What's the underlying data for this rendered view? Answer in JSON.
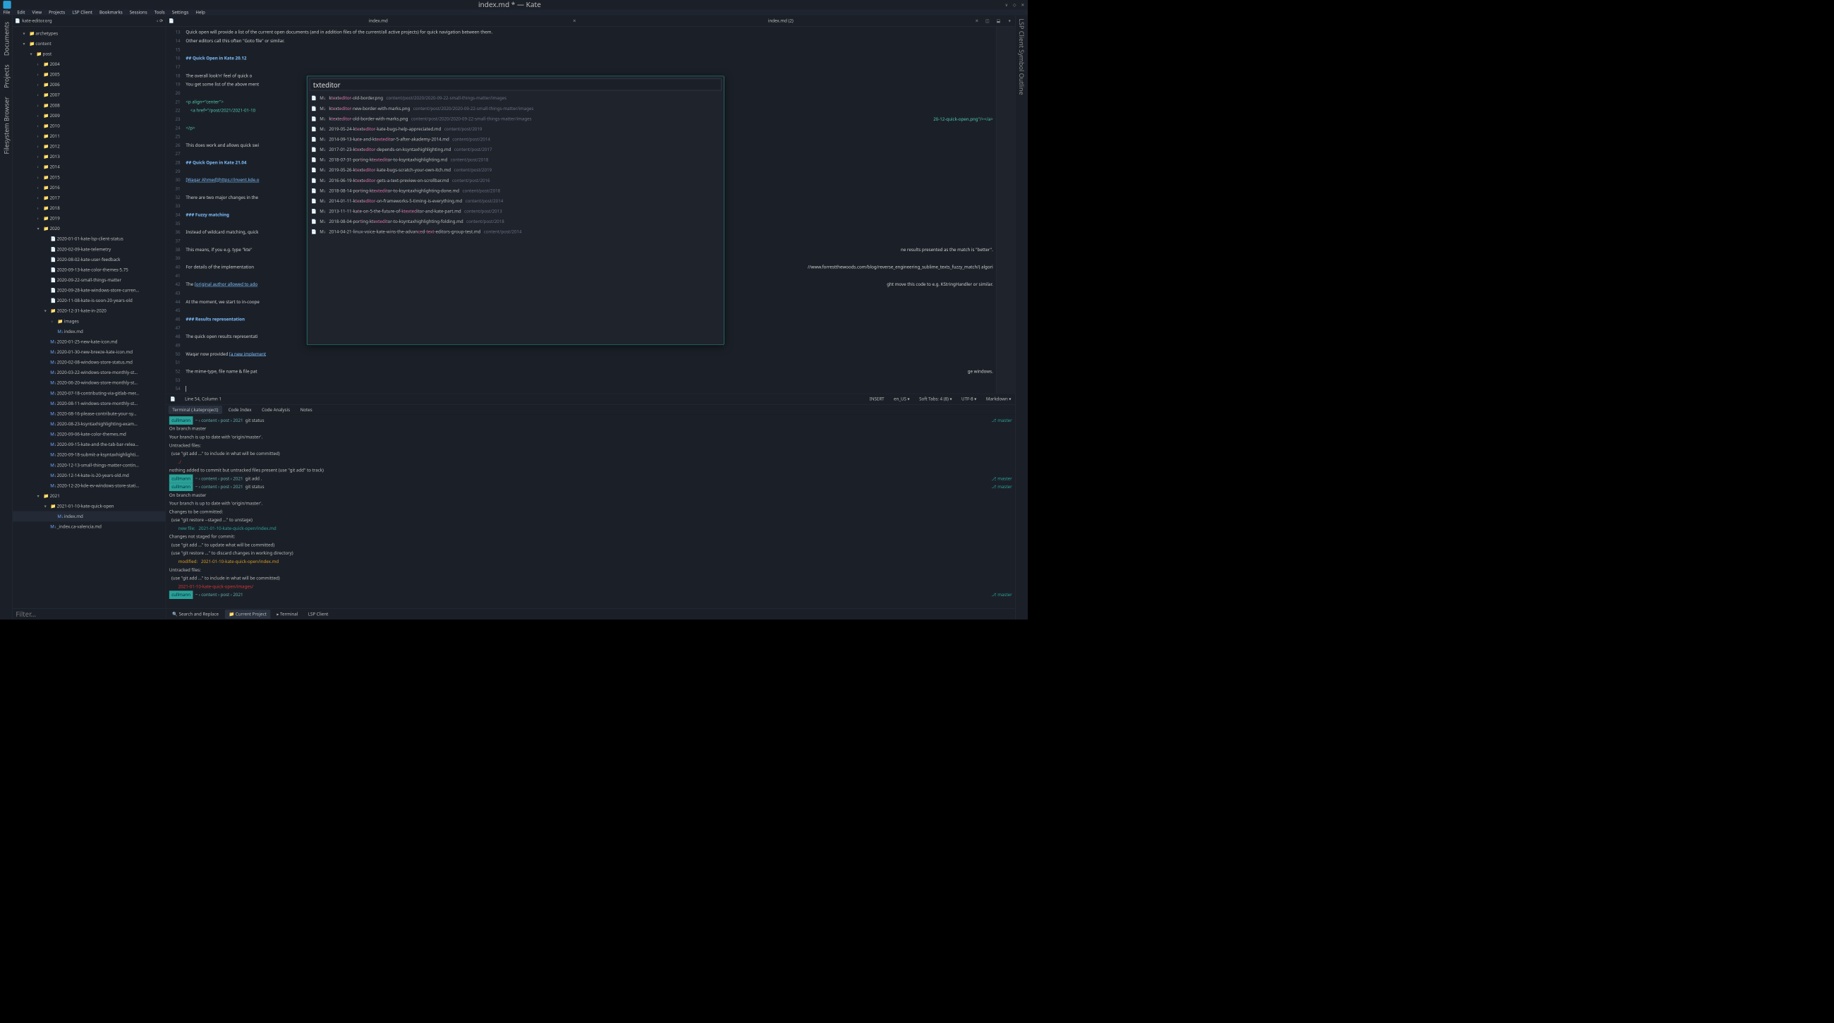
{
  "window": {
    "title": "index.md * — Kate"
  },
  "menubar": [
    "File",
    "Edit",
    "View",
    "Projects",
    "LSP Client",
    "Bookmarks",
    "Sessions",
    "Tools",
    "Settings",
    "Help"
  ],
  "left_sidebar_tabs": [
    "Documents",
    "Projects",
    "Filesystem Browser"
  ],
  "right_sidebar_tab": "LSP Client Symbol Outline",
  "project_name": "kate-editor.org",
  "tree": [
    {
      "d": 1,
      "open": true,
      "folder": true,
      "label": "archetypes"
    },
    {
      "d": 1,
      "open": true,
      "folder": true,
      "label": "content"
    },
    {
      "d": 2,
      "open": true,
      "folder": true,
      "label": "post"
    },
    {
      "d": 3,
      "folder": true,
      "label": "2004"
    },
    {
      "d": 3,
      "folder": true,
      "label": "2005"
    },
    {
      "d": 3,
      "folder": true,
      "label": "2006"
    },
    {
      "d": 3,
      "folder": true,
      "label": "2007"
    },
    {
      "d": 3,
      "folder": true,
      "label": "2008"
    },
    {
      "d": 3,
      "folder": true,
      "label": "2009"
    },
    {
      "d": 3,
      "folder": true,
      "label": "2010"
    },
    {
      "d": 3,
      "folder": true,
      "label": "2011"
    },
    {
      "d": 3,
      "folder": true,
      "label": "2012"
    },
    {
      "d": 3,
      "folder": true,
      "label": "2013"
    },
    {
      "d": 3,
      "folder": true,
      "label": "2014"
    },
    {
      "d": 3,
      "folder": true,
      "label": "2015"
    },
    {
      "d": 3,
      "folder": true,
      "label": "2016"
    },
    {
      "d": 3,
      "folder": true,
      "label": "2017"
    },
    {
      "d": 3,
      "folder": true,
      "label": "2018"
    },
    {
      "d": 3,
      "folder": true,
      "label": "2019"
    },
    {
      "d": 3,
      "open": true,
      "folder": true,
      "label": "2020"
    },
    {
      "d": 4,
      "file": true,
      "label": "2020-01-01-kate-lsp-client-status"
    },
    {
      "d": 4,
      "file": true,
      "label": "2020-02-09-kate-telemetry"
    },
    {
      "d": 4,
      "file": true,
      "label": "2020-08-02-kate-user-feedback"
    },
    {
      "d": 4,
      "file": true,
      "label": "2020-09-13-kate-color-themes-5.75"
    },
    {
      "d": 4,
      "file": true,
      "label": "2020-09-22-small-things-matter"
    },
    {
      "d": 4,
      "file": true,
      "label": "2020-09-28-kate-windows-store-curren…"
    },
    {
      "d": 4,
      "file": true,
      "label": "2020-11-08-kate-is-soon-20-years-old"
    },
    {
      "d": 4,
      "open": true,
      "folder": true,
      "label": "2020-12-31-kate-in-2020"
    },
    {
      "d": 5,
      "folder": true,
      "label": "images"
    },
    {
      "d": 5,
      "file": true,
      "md": true,
      "label": "index.md"
    },
    {
      "d": 4,
      "file": true,
      "md": true,
      "label": "2020-01-25-new-kate-icon.md"
    },
    {
      "d": 4,
      "file": true,
      "md": true,
      "label": "2020-01-30-new-breeze-kate-icon.md"
    },
    {
      "d": 4,
      "file": true,
      "md": true,
      "label": "2020-02-08-windows-store-status.md"
    },
    {
      "d": 4,
      "file": true,
      "md": true,
      "label": "2020-03-22-windows-store-monthly-st…"
    },
    {
      "d": 4,
      "file": true,
      "md": true,
      "label": "2020-06-20-windows-store-monthly-st…"
    },
    {
      "d": 4,
      "file": true,
      "md": true,
      "label": "2020-07-18-contributing-via-gitlab-mer…"
    },
    {
      "d": 4,
      "file": true,
      "md": true,
      "label": "2020-08-11-windows-store-monthly-st…"
    },
    {
      "d": 4,
      "file": true,
      "md": true,
      "label": "2020-08-16-please-contribute-your-sy…"
    },
    {
      "d": 4,
      "file": true,
      "md": true,
      "label": "2020-08-23-ksyntaxhighlighting-exam…"
    },
    {
      "d": 4,
      "file": true,
      "md": true,
      "label": "2020-09-06-kate-color-themes.md"
    },
    {
      "d": 4,
      "file": true,
      "md": true,
      "label": "2020-09-15-kate-and-the-tab-bar-relea…"
    },
    {
      "d": 4,
      "file": true,
      "md": true,
      "label": "2020-09-18-submit-a-ksyntaxhighlighti…"
    },
    {
      "d": 4,
      "file": true,
      "md": true,
      "label": "2020-12-13-small-things-matter-contin…"
    },
    {
      "d": 4,
      "file": true,
      "md": true,
      "label": "2020-12-14-kate-is-20-years-old.md"
    },
    {
      "d": 4,
      "file": true,
      "md": true,
      "label": "2020-12-20-kde-ev-windows-store-stati…"
    },
    {
      "d": 3,
      "open": true,
      "folder": true,
      "label": "2021"
    },
    {
      "d": 4,
      "open": true,
      "folder": true,
      "label": "2021-01-10-kate-quick-open"
    },
    {
      "d": 5,
      "file": true,
      "md": true,
      "sel": true,
      "label": "index.md"
    },
    {
      "d": 4,
      "file": true,
      "md": true,
      "label": "_index.ca-valencia.md"
    }
  ],
  "filter_placeholder": "Filter…",
  "tabs": [
    {
      "label": "index.md",
      "close": true
    },
    {
      "label": "index.md (2)",
      "close": true
    }
  ],
  "editor": {
    "first_line_no": 13,
    "lines": [
      {
        "t": "plain",
        "s": "Quick open will provide a list of the current open documents (and in addition files of the current/all active projects) for quick navigation between them."
      },
      {
        "t": "plain",
        "s": "Other editors call this often \"Goto file\" or similar."
      },
      {
        "t": "blank"
      },
      {
        "t": "h2",
        "s": "## Quick Open in Kate 20.12"
      },
      {
        "t": "blank"
      },
      {
        "t": "plain",
        "s": "The overall look'n' feel of quick o"
      },
      {
        "t": "plain",
        "s": "You get some list of the above ment"
      },
      {
        "t": "blank"
      },
      {
        "t": "html",
        "s": "<p align=\"center\">"
      },
      {
        "t": "html",
        "s": "    <a href=\"/post/2021/2021-01-10"
      },
      {
        "t": "html_end",
        "s": "20-12-quick-open.png\"/></a>"
      },
      {
        "t": "html",
        "s": "</p>"
      },
      {
        "t": "blank"
      },
      {
        "t": "plain",
        "s": "This does work and allows quick swi"
      },
      {
        "t": "blank"
      },
      {
        "t": "h2",
        "s": "## Quick Open in Kate 21.04"
      },
      {
        "t": "blank"
      },
      {
        "t": "link",
        "pre": "[Waqar Ahmed]",
        "url": "(https://invent.kde.o"
      },
      {
        "t": "blank"
      },
      {
        "t": "plain",
        "s": "There are two major changes in the"
      },
      {
        "t": "blank"
      },
      {
        "t": "h3",
        "s": "### Fuzzy matching"
      },
      {
        "t": "blank"
      },
      {
        "t": "plain",
        "s": "Instead of wildcard matching, quick"
      },
      {
        "t": "blank"
      },
      {
        "t": "plain",
        "s": "This means, if you e.g. type \"kte\"|ne results presented as the match is \"better\"."
      },
      {
        "t": "blank"
      },
      {
        "t": "plain",
        "s": "For details of the implementation |//www.forrestthewoods.com/blog/reverse_engineering_sublime_texts_fuzzy_match/) algori"
      },
      {
        "t": "blank"
      },
      {
        "t": "link2",
        "pre": "The ",
        "mid": "[original author allowed to ado",
        "post": "|ght move this code to e.g. KStringHandler or similar."
      },
      {
        "t": "blank"
      },
      {
        "t": "plain",
        "s": "At the moment, we start to in-coope"
      },
      {
        "t": "blank"
      },
      {
        "t": "h3",
        "s": "### Results representation"
      },
      {
        "t": "blank"
      },
      {
        "t": "plain",
        "s": "The quick open results representati"
      },
      {
        "t": "blank"
      },
      {
        "t": "link3",
        "s": "Waqar now provided [a new implement"
      },
      {
        "t": "blank"
      },
      {
        "t": "plain",
        "s": "The mime-type, file name & file pat|ge windows."
      },
      {
        "t": "blank"
      },
      {
        "t": "cursor"
      }
    ]
  },
  "statusbar": {
    "doc_icon": "📄",
    "cursor": "Line 54, Column 1",
    "insert": "INSERT",
    "locale": "en_US",
    "tabs": "Soft Tabs: 4 (8)",
    "enc": "UTF-8",
    "mode": "Markdown"
  },
  "term_tabs": [
    "Terminal (.kateproject)",
    "Code Index",
    "Code Analysis",
    "Notes"
  ],
  "terminal": {
    "prompts": [
      {
        "user": "cullmann",
        "path": "~  content  post  2021",
        "cmd": "git status",
        "branch": "master"
      },
      {
        "user": "cullmann",
        "path": "~  content  post  2021",
        "cmd": "git add .",
        "branch": "master"
      },
      {
        "user": "cullmann",
        "path": "~  content  post  2021",
        "cmd": "git status",
        "branch": "master"
      },
      {
        "user": "cullmann",
        "path": "~  content  post  2021",
        "cmd": "",
        "branch": "master"
      }
    ],
    "body1": [
      "On branch master",
      "Your branch is up to date with 'origin/master'.",
      "",
      "Untracked files:",
      "  (use \"git add <file>...\" to include in what will be committed)",
      "        ./",
      "",
      "nothing added to commit but untracked files present (use \"git add\" to track)"
    ],
    "body2": [
      "On branch master",
      "Your branch is up to date with 'origin/master'.",
      "",
      "Changes to be committed:",
      "  (use \"git restore --staged <file>...\" to unstage)",
      "        new file:   2021-01-10-kate-quick-open/index.md",
      "",
      "Changes not staged for commit:",
      "  (use \"git add <file>...\" to update what will be committed)",
      "  (use \"git restore <file>...\" to discard changes in working directory)",
      "        modified:   2021-01-10-kate-quick-open/index.md",
      "",
      "Untracked files:",
      "  (use \"git add <file>...\" to include in what will be committed)",
      "        2021-01-10-kate-quick-open/images/"
    ]
  },
  "bottom_tabs": [
    {
      "icon": "🔍",
      "label": "Search and Replace"
    },
    {
      "icon": "📁",
      "label": "Current Project",
      "active": true
    },
    {
      "icon": "▸",
      "label": "Terminal"
    },
    {
      "icon": "",
      "label": "LSP Client"
    }
  ],
  "quick_open": {
    "query": "txteditor",
    "results": [
      {
        "fn": "ktexteditor-old-border.png",
        "m": [
          1,
          2,
          5,
          6,
          7,
          8,
          9,
          10,
          11
        ],
        "path": "content/post/2020/2020-09-22-small-things-matter/images"
      },
      {
        "fn": "ktexteditor-new-border-with-marks.png",
        "m": [
          1,
          2,
          5,
          6,
          7,
          8,
          9,
          10,
          11
        ],
        "path": "content/post/2020/2020-09-22-small-things-matter/images"
      },
      {
        "fn": "ktexteditor-old-border-with-marks.png",
        "m": [
          1,
          2,
          5,
          6,
          7,
          8,
          9,
          10,
          11
        ],
        "path": "content/post/2020/2020-09-22-small-things-matter/images"
      },
      {
        "fn": "2019-05-24-ktexteditor-kate-bugs-help-appreciated.md",
        "m": [
          12,
          13,
          16,
          17,
          18,
          19,
          20,
          21,
          22
        ],
        "path": "content/post/2019"
      },
      {
        "fn": "2014-09-13-kate-and-ktexteditor-5-after-akademy-2014.md",
        "m": [
          13,
          15,
          22,
          23,
          24,
          25,
          26,
          27,
          28
        ],
        "path": "content/post/2014"
      },
      {
        "fn": "2017-01-23-ktexteditor-depends-on-ksyntaxhighlighting.md",
        "m": [
          12,
          13,
          16,
          17,
          18,
          19,
          20,
          21,
          22
        ],
        "path": "content/post/2017"
      },
      {
        "fn": "2018-07-31-porting-ktexteditor-to-ksyntaxhighlighting.md",
        "m": [
          14,
          18,
          21,
          22,
          23,
          24,
          25,
          26,
          27
        ],
        "path": "content/post/2018"
      },
      {
        "fn": "2019-05-26-ktexteditor-kate-bugs-scratch-your-own-itch.md",
        "m": [
          12,
          13,
          16,
          17,
          18,
          19,
          20,
          21,
          22
        ],
        "path": "content/post/2019"
      },
      {
        "fn": "2016-06-19-ktexteditor-gets-a-text-preview-on-scrollbar.md",
        "m": [
          12,
          13,
          16,
          17,
          18,
          19,
          20,
          21,
          22
        ],
        "path": "content/post/2016"
      },
      {
        "fn": "2018-08-14-porting-ktexteditor-to-ksyntaxhighlighting-done.md",
        "m": [
          14,
          18,
          21,
          22,
          23,
          24,
          25,
          26,
          27
        ],
        "path": "content/post/2018"
      },
      {
        "fn": "2014-01-11-ktexteditor-on-frameworks-5-timing-is-everything.md",
        "m": [
          12,
          13,
          16,
          17,
          18,
          19,
          20,
          21,
          22
        ],
        "path": "content/post/2014"
      },
      {
        "fn": "2013-11-11-kate-on-5-the-future-of-ktexteditor-and-kate-part.md",
        "m": [
          13,
          15,
          35,
          36,
          37,
          38,
          39,
          40,
          41
        ],
        "path": "content/post/2013"
      },
      {
        "fn": "2018-08-04-porting-ktexteditor-to-ksyntaxhighlighting-folding.md",
        "m": [
          14,
          18,
          21,
          22,
          23,
          24,
          25,
          26,
          27
        ],
        "path": "content/post/2018"
      },
      {
        "fn": "2014-04-21-linux-voice-kate-wins-the-advanced-text-editors-group-test.md",
        "m": [
          27,
          29,
          42,
          43,
          45,
          46,
          47,
          48,
          49
        ],
        "path": "content/post/2014"
      }
    ]
  }
}
